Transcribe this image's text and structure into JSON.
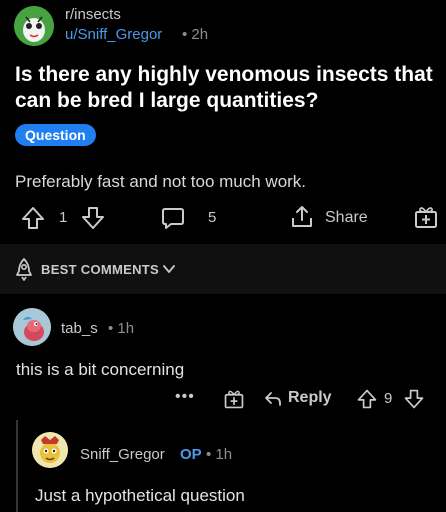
{
  "post": {
    "subreddit": "r/insects",
    "author": "u/Sniff_Gregor",
    "time": "• 2h",
    "title": "Is there any highly venomous insects that can be bred I large quantities?",
    "flair": "Question",
    "body": "Preferably fast and not too much work.",
    "vote_count": "1",
    "comment_count": "5",
    "share_label": "Share"
  },
  "sort": {
    "label": "BEST COMMENTS"
  },
  "comment": {
    "username": "tab_s",
    "time": "• 1h",
    "text": "this is a bit concerning",
    "more": "•••",
    "reply_label": "Reply",
    "votes": "9"
  },
  "reply": {
    "username": "Sniff_Gregor",
    "op_badge": "OP",
    "time": "• 1h",
    "text": "Just a hypothetical question"
  },
  "colors": {
    "background": "#000000",
    "accent_blue": "#4a9ae8",
    "flair": "#1f7ef0",
    "sort_bar": "#101011"
  }
}
